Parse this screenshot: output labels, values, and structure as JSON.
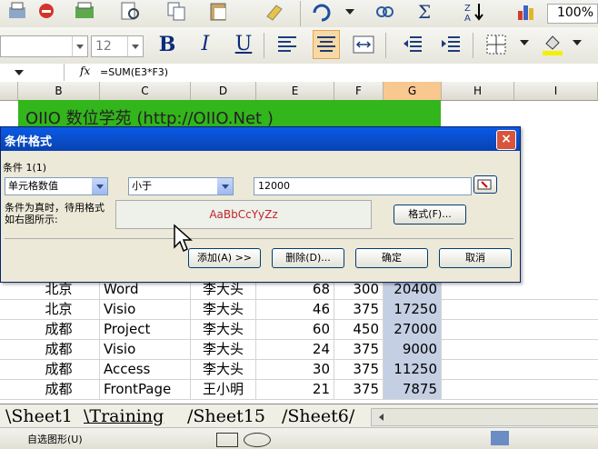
{
  "toolbar": {
    "zoom": "100%",
    "font_size": "12",
    "bold": "B",
    "italic": "I",
    "underline": "U"
  },
  "formula_bar": {
    "fx": "fx",
    "formula": "=SUM(E3*F3)"
  },
  "columns": [
    "B",
    "C",
    "D",
    "E",
    "F",
    "G",
    "H",
    "I"
  ],
  "banner": "OIIO 数位学苑 (http://OIIO.Net )",
  "dialog": {
    "title": "条件格式",
    "condition_label": "条件 1(1)",
    "cond_type": "单元格数值",
    "operator": "小于",
    "value": "12000",
    "preview_label": "条件为真时，待用格式如右图所示:",
    "preview_text": "AaBbCcYyZz",
    "format_btn": "格式(F)...",
    "add_btn": "添加(A) >>",
    "delete_btn": "删除(D)...",
    "ok_btn": "确定",
    "cancel_btn": "取消"
  },
  "rows": [
    {
      "b": "北京",
      "c": "Word",
      "d": "李大头",
      "e": "68",
      "f": "300",
      "g": "20400"
    },
    {
      "b": "北京",
      "c": "Visio",
      "d": "李大头",
      "e": "46",
      "f": "375",
      "g": "17250"
    },
    {
      "b": "成都",
      "c": "Project",
      "d": "李大头",
      "e": "60",
      "f": "450",
      "g": "27000"
    },
    {
      "b": "成都",
      "c": "Visio",
      "d": "李大头",
      "e": "24",
      "f": "375",
      "g": "9000"
    },
    {
      "b": "成都",
      "c": "Access",
      "d": "李大头",
      "e": "30",
      "f": "375",
      "g": "11250"
    },
    {
      "b": "成都",
      "c": "FrontPage",
      "d": "王小明",
      "e": "21",
      "f": "375",
      "g": "7875"
    }
  ],
  "sheet_tabs": [
    "Sheet1",
    "Training",
    "Sheet15",
    "Sheet6"
  ],
  "draw_bar": {
    "autoshapes": "自选图形(U)"
  },
  "colors": {
    "banner": "#33b51c",
    "selected_column": "#c4cfe4",
    "title_bar": "#0a5ae6"
  }
}
